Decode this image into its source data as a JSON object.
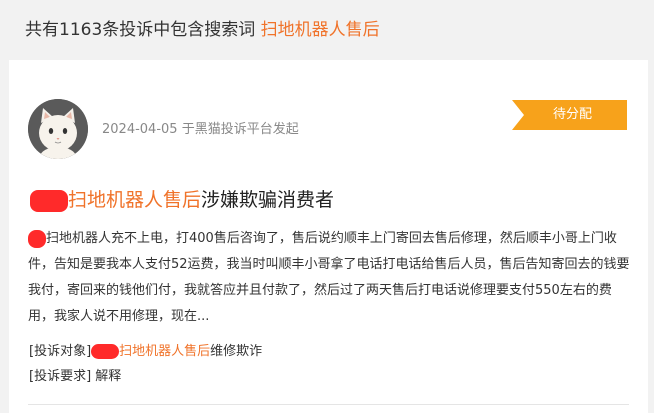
{
  "search_summary": {
    "prefix": "共有1163条投诉中包含搜索词",
    "keyword": "扫地机器人售后"
  },
  "complaint": {
    "date": "2024-04-05",
    "source_text": "于黑猫投诉平台发起",
    "status": "待分配",
    "title_keyword": "扫地机器人售后",
    "title_suffix": "涉嫌欺骗消费者",
    "body": "扫地机器人充不上电，打400售后咨询了，售后说约顺丰上门寄回去售后修理，然后顺丰小哥上门收件，告知是要我本人支付52运费，我当时叫顺丰小哥拿了电话打电话给售后人员，售后告知寄回去的钱要我付，寄回来的钱他们付，我就答应并且付款了，然后过了两天售后打电话说修理要支付550左右的费用，我家人说不用修理，现在...",
    "target_label": "[投诉对象]",
    "target_keyword": "扫地机器人售后",
    "target_suffix": "维修欺诈",
    "request_label": "[投诉要求]",
    "request_value": "解释"
  },
  "colors": {
    "accent": "#f0732a",
    "badge": "#f7a21b",
    "redaction": "#ff2a2a"
  },
  "icons": {
    "avatar": "cat-avatar-icon"
  }
}
